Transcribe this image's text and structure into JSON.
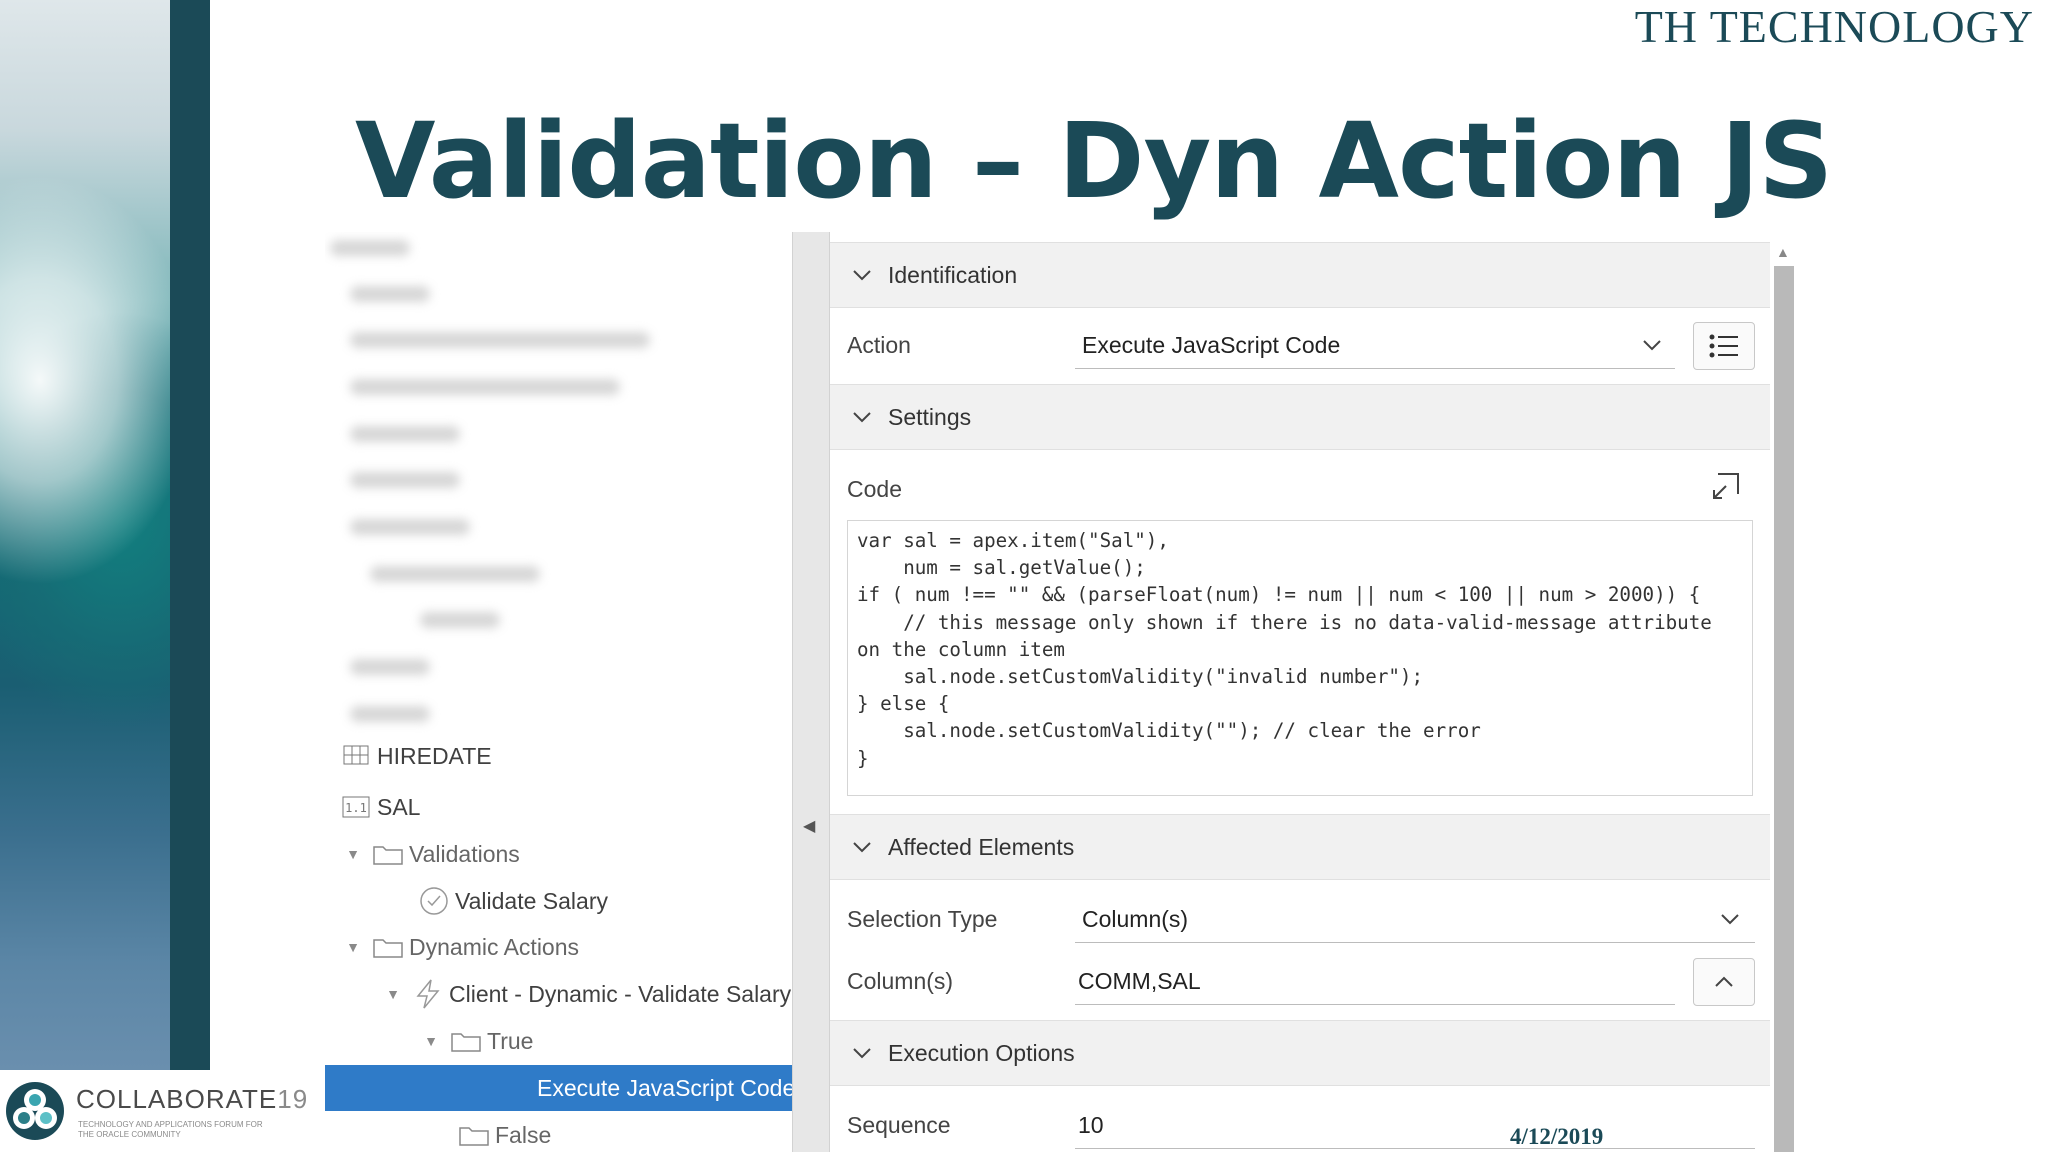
{
  "company": "TH TECHNOLOGY",
  "title": "Validation – Dyn Action JS",
  "brand": {
    "name": "COLLABORATE",
    "number": "19",
    "tagline": "TECHNOLOGY AND APPLICATIONS FORUM FOR THE ORACLE COMMUNITY"
  },
  "date": "4/12/2019",
  "tree": {
    "items": [
      {
        "label": "HIREDATE",
        "icon": "grid-icon"
      },
      {
        "label": "SAL",
        "icon": "number-column-icon"
      },
      {
        "label": "Validations",
        "icon": "folder-icon"
      },
      {
        "label": "Validate Salary",
        "icon": "check-circle-icon"
      },
      {
        "label": "Dynamic Actions",
        "icon": "folder-icon"
      },
      {
        "label": "Client - Dynamic - Validate Salary",
        "icon": "lightning-icon"
      },
      {
        "label": "True",
        "icon": "folder-icon"
      },
      {
        "label": "Execute JavaScript Code",
        "icon": ""
      },
      {
        "label": "False",
        "icon": "folder-icon"
      }
    ]
  },
  "props": {
    "identification": {
      "header": "Identification",
      "action_label": "Action",
      "action_value": "Execute JavaScript Code"
    },
    "settings": {
      "header": "Settings",
      "code_label": "Code",
      "code": "var sal = apex.item(\"Sal\"),\n    num = sal.getValue();\nif ( num !== \"\" && (parseFloat(num) != num || num < 100 || num > 2000)) {\n    // this message only shown if there is no data-valid-message attribute\non the column item\n    sal.node.setCustomValidity(\"invalid number\");\n} else {\n    sal.node.setCustomValidity(\"\"); // clear the error\n}"
    },
    "affected": {
      "header": "Affected Elements",
      "selection_type_label": "Selection Type",
      "selection_type_value": "Column(s)",
      "columns_label": "Column(s)",
      "columns_value": "COMM,SAL"
    },
    "execution": {
      "header": "Execution Options",
      "sequence_label": "Sequence",
      "sequence_value": "10"
    }
  },
  "colors": {
    "accent": "#1b4a57",
    "selection": "#2f7bc8"
  }
}
